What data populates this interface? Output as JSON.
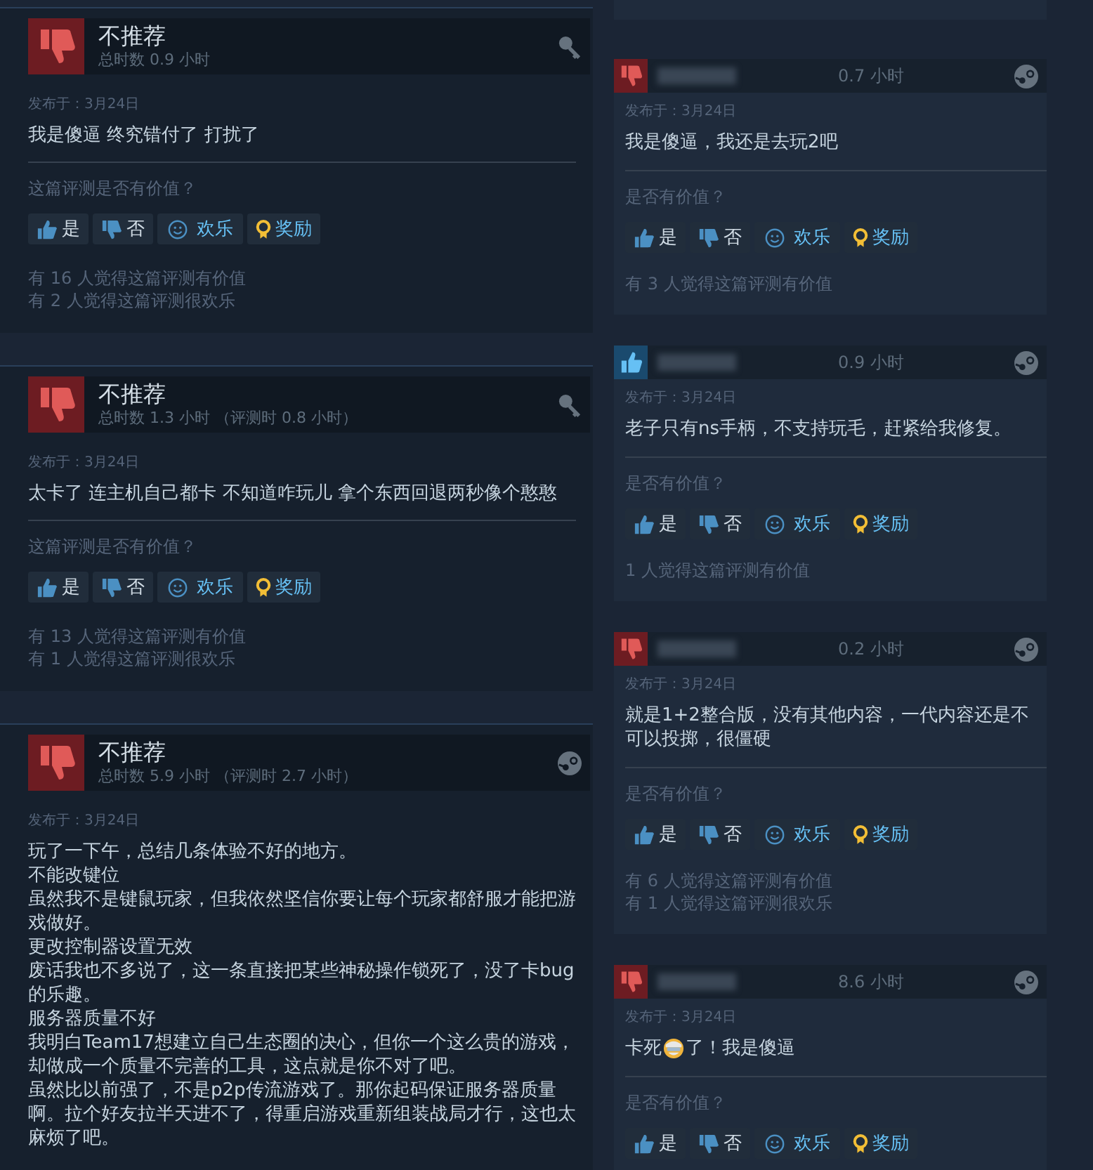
{
  "left_reviews": [
    {
      "verdict": "不推荐",
      "recommended": false,
      "hours": "总时数 0.9 小时",
      "kind": "key",
      "posted": "发布于：3月24日",
      "body": [
        [
          "我是傻逼 终究错付了 打扰了"
        ]
      ],
      "question": "这篇评测是否有价值？",
      "buttons": [
        {
          "kind": "up",
          "label": "是"
        },
        {
          "kind": "down",
          "label": "否"
        },
        {
          "kind": "funny",
          "label": "欢乐"
        },
        {
          "kind": "award",
          "label": "奖励"
        }
      ],
      "stats": [
        "有 16 人觉得这篇评测有价值",
        "有 2 人觉得这篇评测很欢乐"
      ]
    },
    {
      "verdict": "不推荐",
      "recommended": false,
      "hours": "总时数 1.3 小时 （评测时 0.8 小时）",
      "kind": "key",
      "posted": "发布于：3月24日",
      "body": [
        [
          "太卡了 连主机自己都卡 不知道咋玩儿 拿个东西回退两秒像个憨憨"
        ]
      ],
      "question": "这篇评测是否有价值？",
      "buttons": [
        {
          "kind": "up",
          "label": "是"
        },
        {
          "kind": "down",
          "label": "否"
        },
        {
          "kind": "funny",
          "label": "欢乐"
        },
        {
          "kind": "award",
          "label": "奖励"
        }
      ],
      "stats": [
        "有 13 人觉得这篇评测有价值",
        "有 1 人觉得这篇评测很欢乐"
      ]
    },
    {
      "verdict": "不推荐",
      "recommended": false,
      "hours": "总时数 5.9 小时 （评测时 2.7 小时）",
      "kind": "steam",
      "posted": "发布于：3月24日",
      "body": [
        [
          "玩了一下午，总结几条体验不好的地方。"
        ],
        [
          "不能改键位"
        ],
        [
          "虽然我不是键鼠玩家，但我依然坚信你要让每个玩家都舒服才能把游戏做好。"
        ],
        [
          "更改控制器设置无效"
        ],
        [
          "废话我也不多说了，这一条直接把某些神秘操作锁死了，没了卡bug的乐趣。"
        ],
        [
          "服务器质量不好"
        ],
        [
          "我明白Team17想建立自己生态圈的决心，但你一个这么贵的游戏，却做成一个质量不完善的工具，这点就是你不对了吧。"
        ],
        [
          "虽然比以前强了，不是p2p传流游戏了。那你起码保证服务器质量啊。拉个好友拉半天进不了，得重启游戏重新组装战局才行，这也太麻烦了吧。"
        ]
      ]
    }
  ],
  "right_reviews": [
    {
      "recommended": false,
      "hours": "0.7 小时",
      "kind": "steam",
      "posted": "发布于：3月24日",
      "body": [
        [
          "我是傻逼，我还是去玩2吧"
        ]
      ],
      "question": "是否有价值？",
      "buttons": [
        {
          "kind": "up",
          "label": "是"
        },
        {
          "kind": "down",
          "label": "否"
        },
        {
          "kind": "funny",
          "label": "欢乐"
        },
        {
          "kind": "award",
          "label": "奖励"
        }
      ],
      "stats": [
        "有 3 人觉得这篇评测有价值"
      ]
    },
    {
      "recommended": true,
      "hours": "0.9 小时",
      "kind": "steam",
      "posted": "发布于：3月24日",
      "body": [
        [
          "老子只有ns手柄，不支持玩毛，赶紧给我修复。"
        ]
      ],
      "question": "是否有价值？",
      "buttons": [
        {
          "kind": "up",
          "label": "是"
        },
        {
          "kind": "down",
          "label": "否"
        },
        {
          "kind": "funny",
          "label": "欢乐"
        },
        {
          "kind": "award",
          "label": "奖励"
        }
      ],
      "stats": [
        "1 人觉得这篇评测有价值"
      ]
    },
    {
      "recommended": false,
      "hours": "0.2 小时",
      "kind": "steam",
      "posted": "发布于：3月24日",
      "body": [
        [
          "就是1+2整合版，没有其他内容，一代内容还是不可以投掷，很僵硬"
        ]
      ],
      "question": "是否有价值？",
      "buttons": [
        {
          "kind": "up",
          "label": "是"
        },
        {
          "kind": "down",
          "label": "否"
        },
        {
          "kind": "funny",
          "label": "欢乐"
        },
        {
          "kind": "award",
          "label": "奖励"
        }
      ],
      "stats": [
        "有 6 人觉得这篇评测有价值",
        "有 1 人觉得这篇评测很欢乐"
      ]
    },
    {
      "recommended": false,
      "hours": "8.6 小时",
      "kind": "steam",
      "posted": "发布于：3月24日",
      "body": [
        [
          "卡死",
          {
            "kind": "emoji"
          },
          "了！我是傻逼"
        ]
      ],
      "question": "是否有价值？",
      "buttons": [
        {
          "kind": "up",
          "label": "是"
        },
        {
          "kind": "down",
          "label": "否"
        },
        {
          "kind": "funny",
          "label": "欢乐"
        },
        {
          "kind": "award",
          "label": "奖励"
        }
      ]
    }
  ]
}
